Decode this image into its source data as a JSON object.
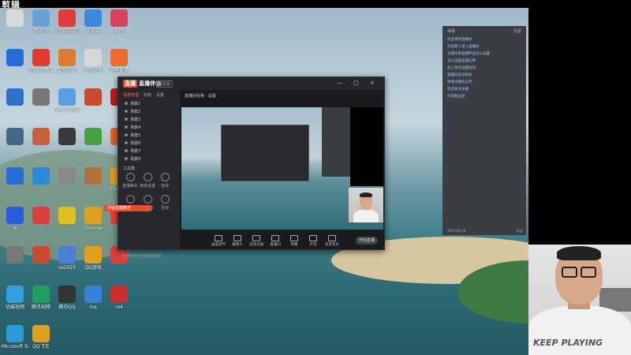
{
  "topbar": {
    "text": "剪辑"
  },
  "desktop_icons": [
    {
      "label": "",
      "color": "#d9d9d9"
    },
    {
      "label": "回收站",
      "color": "#6aa0d8"
    },
    {
      "label": "华为应用市场",
      "color": "#e03a3a"
    },
    {
      "label": "此电脑",
      "color": "#3a8ad9"
    },
    {
      "label": "剪映",
      "color": "#d84060"
    },
    {
      "label": "",
      "color": "#2a6bd8"
    },
    {
      "label": "WPS Office",
      "color": "#e23b2e"
    },
    {
      "label": "智慧大师",
      "color": "#e07a30"
    },
    {
      "label": "录制文件",
      "color": "#d8d8d8"
    },
    {
      "label": "抖音直播",
      "color": "#ec6a30"
    },
    {
      "label": "",
      "color": "#3070c8"
    },
    {
      "label": "",
      "color": "#777"
    },
    {
      "label": "Screenshot",
      "color": "#5aa0e0"
    },
    {
      "label": "",
      "color": "#c84a30"
    },
    {
      "label": "",
      "color": "#b02020"
    },
    {
      "label": "",
      "color": "#446688"
    },
    {
      "label": "",
      "color": "#c86040"
    },
    {
      "label": "",
      "color": "#3a3a3a"
    },
    {
      "label": "",
      "color": "#4aa040"
    },
    {
      "label": "",
      "color": "#e06030"
    },
    {
      "label": "",
      "color": "#2a6bd8"
    },
    {
      "label": "",
      "color": "#2a8ad8"
    },
    {
      "label": "",
      "color": "#888"
    },
    {
      "label": "",
      "color": "#b07040"
    },
    {
      "label": "Chrome",
      "color": "#e0a020"
    },
    {
      "label": "W",
      "color": "#2a5bd8"
    },
    {
      "label": "",
      "color": "#d84040"
    },
    {
      "label": "",
      "color": "#e0c020"
    },
    {
      "label": "Chrome",
      "color": "#e0a020"
    },
    {
      "label": "",
      "color": "#e04040"
    },
    {
      "label": "",
      "color": "#777"
    },
    {
      "label": "",
      "color": "#c84a30"
    },
    {
      "label": "vs2023",
      "color": "#4a80d8"
    },
    {
      "label": "QQ游戏",
      "color": "#e0a020"
    },
    {
      "label": "",
      "color": "#d84040"
    },
    {
      "label": "优酷视频",
      "color": "#30a0e0"
    },
    {
      "label": "腾讯视频",
      "color": "#20a060"
    },
    {
      "label": "腾讯QQ",
      "color": "#333"
    },
    {
      "label": "me",
      "color": "#3a80d8"
    },
    {
      "label": "ro4",
      "color": "#c83030"
    },
    {
      "label": "Microsoft Edge",
      "color": "#2a9ad8"
    },
    {
      "label": "QQ飞车",
      "color": "#e0a020"
    }
  ],
  "app": {
    "logo_badge": "直播",
    "logo_text": "直播伴侣",
    "version": "体验版",
    "window_buttons": "— □ ×",
    "sidebar_tabs": [
      "场景管理",
      "布局",
      "设置"
    ],
    "scenes": [
      "场景1",
      "场景2",
      "场景3",
      "场景4",
      "场景5",
      "场景6",
      "场景7",
      "场景8"
    ],
    "tools_label": "工具箱",
    "tools": [
      "直播美化",
      "高级设置",
      "音效",
      "连麦",
      "画中画",
      "互动"
    ],
    "orange_button": "开始直播教学",
    "bottom_text": "直播伴侣已连接服务器",
    "toolbar_text": "直播间名称 · 设置",
    "bottom_items": [
      "画面调节",
      "摄像头",
      "连线主播",
      "直播间",
      "弹幕",
      "声音",
      "背景音乐"
    ],
    "live_button": "开始直播"
  },
  "chat": {
    "title": "弹幕",
    "settings": "设置",
    "messages": [
      "欢迎来到直播间",
      "",
      "",
      "",
      "",
      "",
      "",
      "欢迎新人进入直播间",
      "主播在教直播伴侣怎么设置",
      "怎么设置画面比例",
      "右上角有设置按钮",
      "直播间互动很多",
      "感谢主播的分享",
      "",
      "",
      "",
      "",
      "",
      "",
      "",
      "",
      "欢迎关注主播",
      "点亮粉丝团"
    ],
    "footer_left": "2023-09-14",
    "footer_right": "发送"
  },
  "webcam": {
    "shirt_text": "KEEP PLAYING"
  }
}
